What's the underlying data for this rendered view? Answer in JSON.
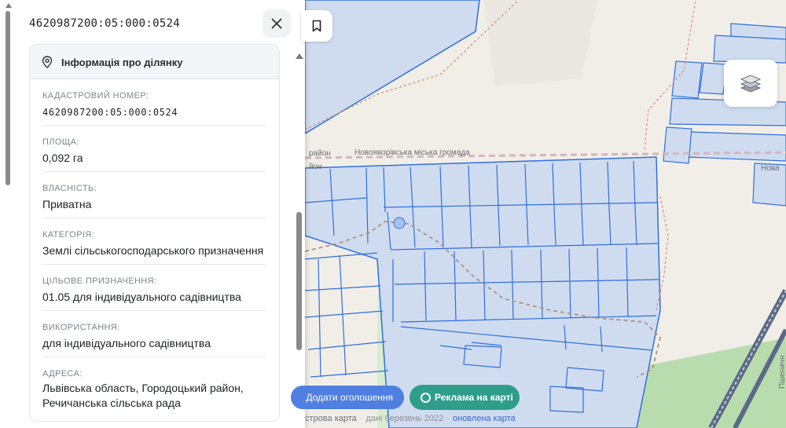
{
  "panel": {
    "title": "4620987200:05:000:0524",
    "card_title": "Інформація про ділянку",
    "fields": [
      {
        "label": "КАДАСТРОВИЙ НОМЕР:",
        "value": "4620987200:05:000:0524"
      },
      {
        "label": "ПЛОЩА:",
        "value": "0,092 га"
      },
      {
        "label": "ВЛАСНІСТЬ:",
        "value": "Приватна"
      },
      {
        "label": "КАТЕГОРІЯ:",
        "value": "Землі сільськогосподарського призначення"
      },
      {
        "label": "ЦІЛЬОВЕ ПРИЗНАЧЕННЯ:",
        "value": "01.05 для індивідуального садівництва"
      },
      {
        "label": "ВИКОРИСТАННЯ:",
        "value": "для індивідуального садівництва"
      },
      {
        "label": "АДРЕСА:",
        "value": "Львівська область, Городоцький район, Речичанська сільська рада"
      }
    ]
  },
  "map": {
    "labels": {
      "district_left": "район",
      "district_left_2": "йон",
      "community": "Новояворівська міська громада",
      "community_right": "Нова",
      "street_vertical": "Пшеничн"
    }
  },
  "buttons": {
    "add_listing": "Додати оголошення",
    "ads_on_map": "Реклама на карті"
  },
  "attribution": {
    "source": "строва карта",
    "date": "дані березень 2022",
    "updated": "оновлена карта"
  },
  "icons": {
    "close": "close-icon",
    "pin": "location-pin-icon",
    "bookmark": "bookmark-icon",
    "layers": "layers-icon"
  },
  "colors": {
    "parcel_stroke": "#2f6fe0",
    "parcel_fill": "#cfdcf0",
    "ads_button": "#2e9e8a",
    "add_button": "#4f7fe0"
  }
}
